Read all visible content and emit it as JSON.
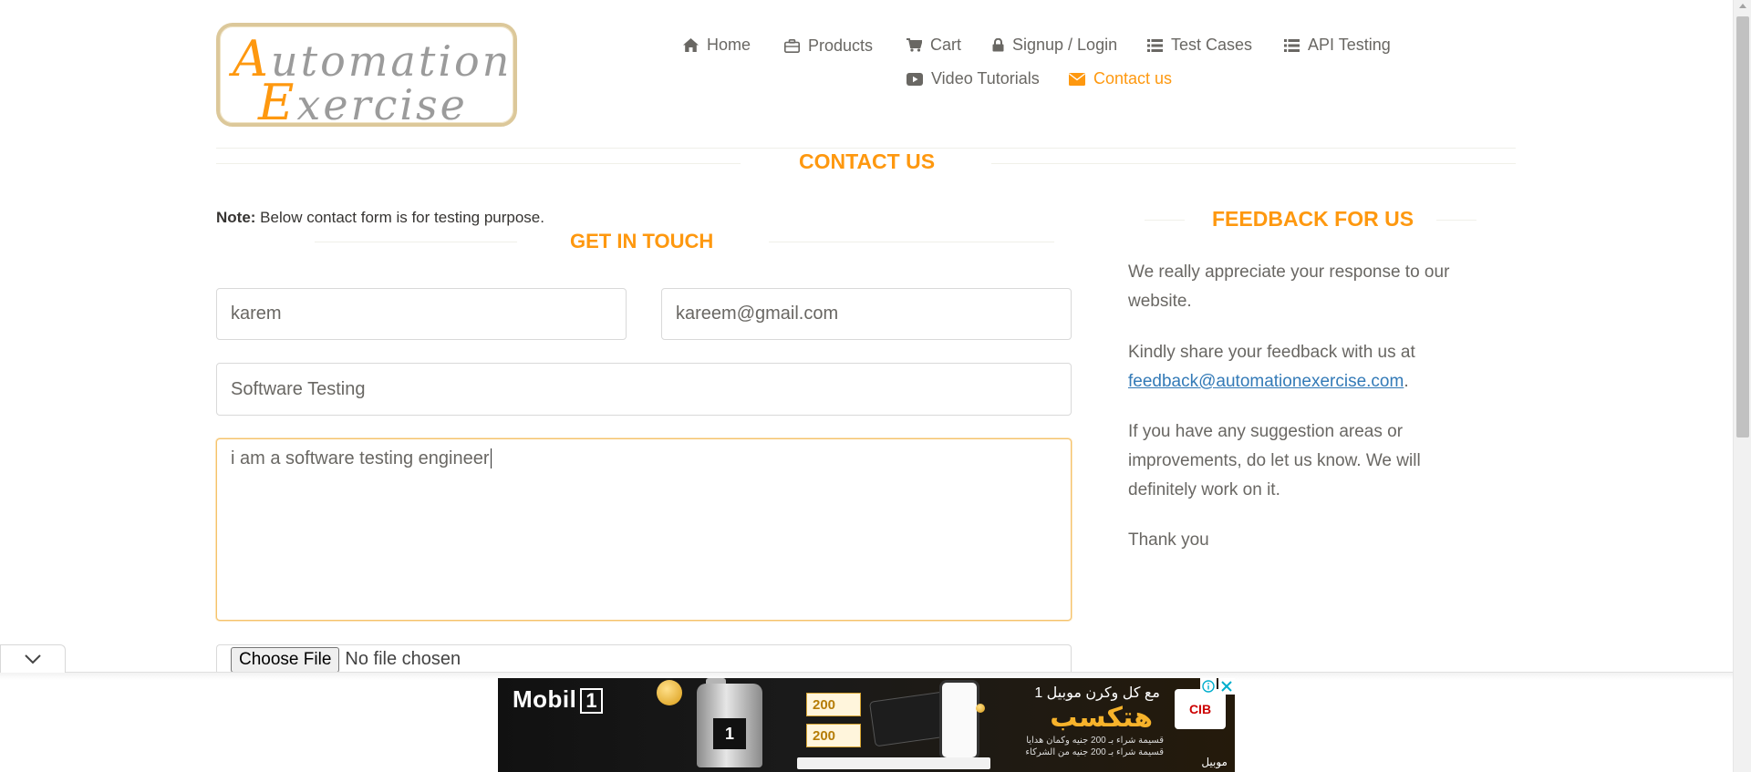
{
  "logo": {
    "line1_cap": "A",
    "line1_rest": "utomation",
    "line2_cap": "E",
    "line2_rest": "xercise"
  },
  "nav": [
    {
      "label": "Home",
      "icon": "home-icon"
    },
    {
      "label": "Products",
      "icon": "briefcase-icon"
    },
    {
      "label": "Cart",
      "icon": "cart-icon"
    },
    {
      "label": "Signup / Login",
      "icon": "lock-icon"
    },
    {
      "label": "Test Cases",
      "icon": "list-icon"
    },
    {
      "label": "API Testing",
      "icon": "list-icon"
    },
    {
      "label": "Video Tutorials",
      "icon": "youtube-icon"
    },
    {
      "label": "Contact us",
      "icon": "envelope-icon",
      "active": true
    }
  ],
  "page": {
    "title": "CONTACT US",
    "note_label": "Note:",
    "note_text": " Below contact form is for testing purpose."
  },
  "form": {
    "heading": "GET IN TOUCH",
    "name_value": "karem",
    "email_value": "kareem@gmail.com",
    "subject_value": "Software Testing",
    "message_value": "i am a software testing engineer",
    "file_button": "Choose File",
    "file_status": "No file chosen"
  },
  "feedback": {
    "heading": "FEEDBACK FOR US",
    "p1": "We really appreciate your response to our website.",
    "p2_prefix": "Kindly share your feedback with us at ",
    "p2_link": "feedback@automationexercise.com",
    "p2_suffix": ".",
    "p3": "If you have any suggestion areas or improvements, do let us know. We will definitely work on it.",
    "p4": "Thank you"
  },
  "ad": {
    "brand": "Mobil",
    "brand_one": "1",
    "arabic_top": "مع كل وكرن موبيل 1",
    "arabic_big": "هتكسب",
    "arabic_small1": "قسيمة شراء بـ 200 جنيه وكمان هدايا",
    "arabic_small2": "قسيمة شراء بـ 200 جنيه من الشركاء",
    "voucher1": "200",
    "voucher2": "200",
    "bottle_label": "1",
    "bank": "CIB",
    "mobile_brand": "موبيل"
  },
  "colors": {
    "accent": "#fe980f",
    "text": "#696763",
    "link": "#337ab7"
  }
}
